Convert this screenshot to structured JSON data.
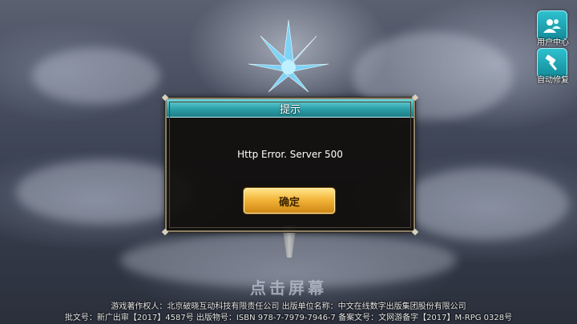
{
  "side_buttons": [
    {
      "label": "用户中心",
      "icon": "users-icon"
    },
    {
      "label": "自动修复",
      "icon": "hammer-icon"
    }
  ],
  "dialog": {
    "title": "提示",
    "message": "Http Error. Server 500",
    "ok_label": "确定"
  },
  "tap_prompt": "点击屏幕",
  "footer": {
    "line1": "游戏著作权人：北京破晓互动科技有限责任公司  出版单位名称：中文在线数字出版集团股份有限公司",
    "line2": "批文号：新广出审【2017】4587号   出版物号：ISBN 978-7-7979-7946-7   备案文号：文网游备字【2017】M-RPG 0328号"
  },
  "colors": {
    "title_bar": "#2c9fa8",
    "button_gold": "#f3b539",
    "side_button": "#2ec1cf"
  }
}
